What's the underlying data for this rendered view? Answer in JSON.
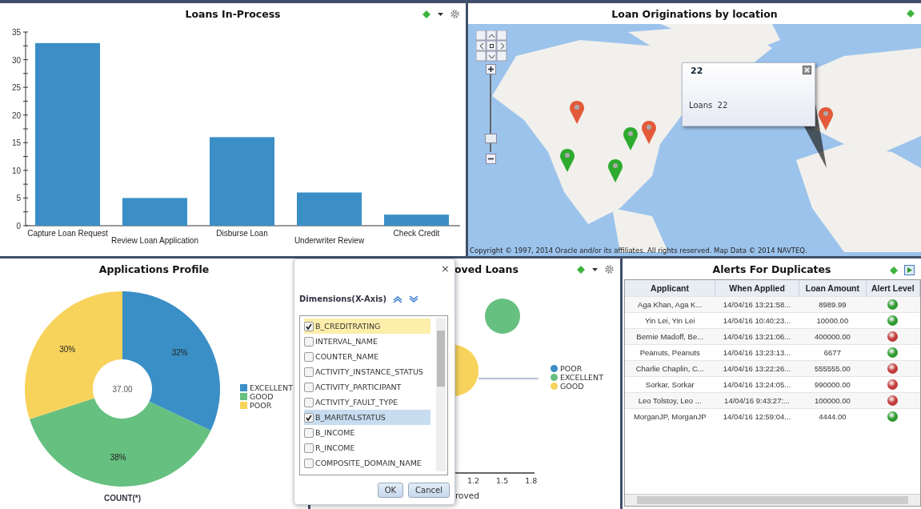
{
  "loans_in_process": {
    "title": "Loans In-Process",
    "chart_data": {
      "type": "bar",
      "categories": [
        "Capture Loan Request",
        "Review Loan Application",
        "Disburse Loan",
        "Underwriter Review",
        "Check Credit"
      ],
      "values": [
        33,
        5,
        16,
        6,
        2
      ],
      "ylim": [
        0,
        35
      ],
      "yticks": [
        0,
        5,
        10,
        15,
        20,
        25,
        30,
        35
      ]
    }
  },
  "loan_originations": {
    "title": "Loan Originations by location",
    "pins": [
      {
        "color": "#e35a3a"
      },
      {
        "color": "#2eaa2e"
      },
      {
        "color": "#e35a3a"
      },
      {
        "color": "#2eaa2e"
      },
      {
        "color": "#2eaa2e"
      },
      {
        "color": "#e35a3a"
      }
    ],
    "popup": {
      "title": "22",
      "label": "Loans",
      "value": "22"
    },
    "zoom": {
      "level": 0.15
    },
    "copyright": "Copyright © 1997, 2014 Oracle and/or its affiliates. All rights reserved. Map Data © 2014 NAVTEQ."
  },
  "applications_profile": {
    "title": "Applications Profile",
    "chart_data": {
      "type": "donut",
      "categories": [
        "EXCELLENT",
        "GOOD",
        "POOR"
      ],
      "values": [
        32,
        38,
        30
      ],
      "value_labels": [
        "32%",
        "38%",
        "30%"
      ],
      "xlabel": "COUNT(*)"
    },
    "center_label": "37.00",
    "legend": [
      {
        "color": "#3a8fc6"
      },
      {
        "color": "#66c080"
      },
      {
        "color": "#f8d35c"
      }
    ]
  },
  "approved_loans": {
    "title": "oved Loans",
    "xticks": [
      "1.2",
      "1.5",
      "1.8"
    ],
    "xlabel": "roved",
    "legend": [
      {
        "label": "POOR",
        "color": "#3a8fc6"
      },
      {
        "label": "EXCELLENT",
        "color": "#66c080"
      },
      {
        "label": "GOOD",
        "color": "#f8d35c"
      }
    ]
  },
  "dimensions_dialog": {
    "close": "×",
    "title": "Dimensions(X-Axis)",
    "items": [
      {
        "label": "B_CREDITRATING",
        "checked": true,
        "selected": false,
        "highlighted": true
      },
      {
        "label": "INTERVAL_NAME",
        "checked": false,
        "selected": false,
        "highlighted": false
      },
      {
        "label": "COUNTER_NAME",
        "checked": false,
        "selected": false,
        "highlighted": false
      },
      {
        "label": "ACTIVITY_INSTANCE_STATUS",
        "checked": false,
        "selected": false,
        "highlighted": false
      },
      {
        "label": "ACTIVITY_PARTICIPANT",
        "checked": false,
        "selected": false,
        "highlighted": false
      },
      {
        "label": "ACTIVITY_FAULT_TYPE",
        "checked": false,
        "selected": false,
        "highlighted": false
      },
      {
        "label": "B_MARITALSTATUS",
        "checked": true,
        "selected": true,
        "highlighted": false
      },
      {
        "label": "B_INCOME",
        "checked": false,
        "selected": false,
        "highlighted": false
      },
      {
        "label": "R_INCOME",
        "checked": false,
        "selected": false,
        "highlighted": false
      },
      {
        "label": "COMPOSITE_DOMAIN_NAME",
        "checked": false,
        "selected": false,
        "highlighted": false
      }
    ],
    "buttons": [
      "OK",
      "Cancel"
    ]
  },
  "alerts": {
    "title": "Alerts For Duplicates",
    "columns": [
      "Applicant",
      "When Applied",
      "Loan Amount",
      "Alert Level"
    ],
    "rows": [
      {
        "applicant": "Aga Khan, Aga K...",
        "when_applied": "14/04/16 13:21:58...",
        "loan_amount": "8989.99",
        "color": "#2e9a2e"
      },
      {
        "applicant": "Yin Lei, Yin Lei",
        "when_applied": "14/04/16 10:40:23...",
        "loan_amount": "10000.00",
        "color": "#2e9a2e"
      },
      {
        "applicant": "Bernie Madoff, Be...",
        "when_applied": "14/04/16 13:21:06...",
        "loan_amount": "400000.00",
        "color": "#c23b3b"
      },
      {
        "applicant": "Peanuts, Peanuts",
        "when_applied": "14/04/16 13:23:13...",
        "loan_amount": "6677",
        "color": "#2e9a2e"
      },
      {
        "applicant": "Charlie Chaplin, C...",
        "when_applied": "14/04/16 13:22:26...",
        "loan_amount": "555555.00",
        "color": "#c23b3b"
      },
      {
        "applicant": "Sorkar, Sorkar",
        "when_applied": "14/04/16 13:24:05...",
        "loan_amount": "990000.00",
        "color": "#c23b3b"
      },
      {
        "applicant": "Leo Tolstoy, Leo ...",
        "when_applied": "14/04/16 9:43:27:...",
        "loan_amount": "100000.00",
        "color": "#c23b3b"
      },
      {
        "applicant": "MorganJP, MorganJP",
        "when_applied": "14/04/16 12:59:04...",
        "loan_amount": "4444.00",
        "color": "#2e9a2e"
      }
    ]
  }
}
